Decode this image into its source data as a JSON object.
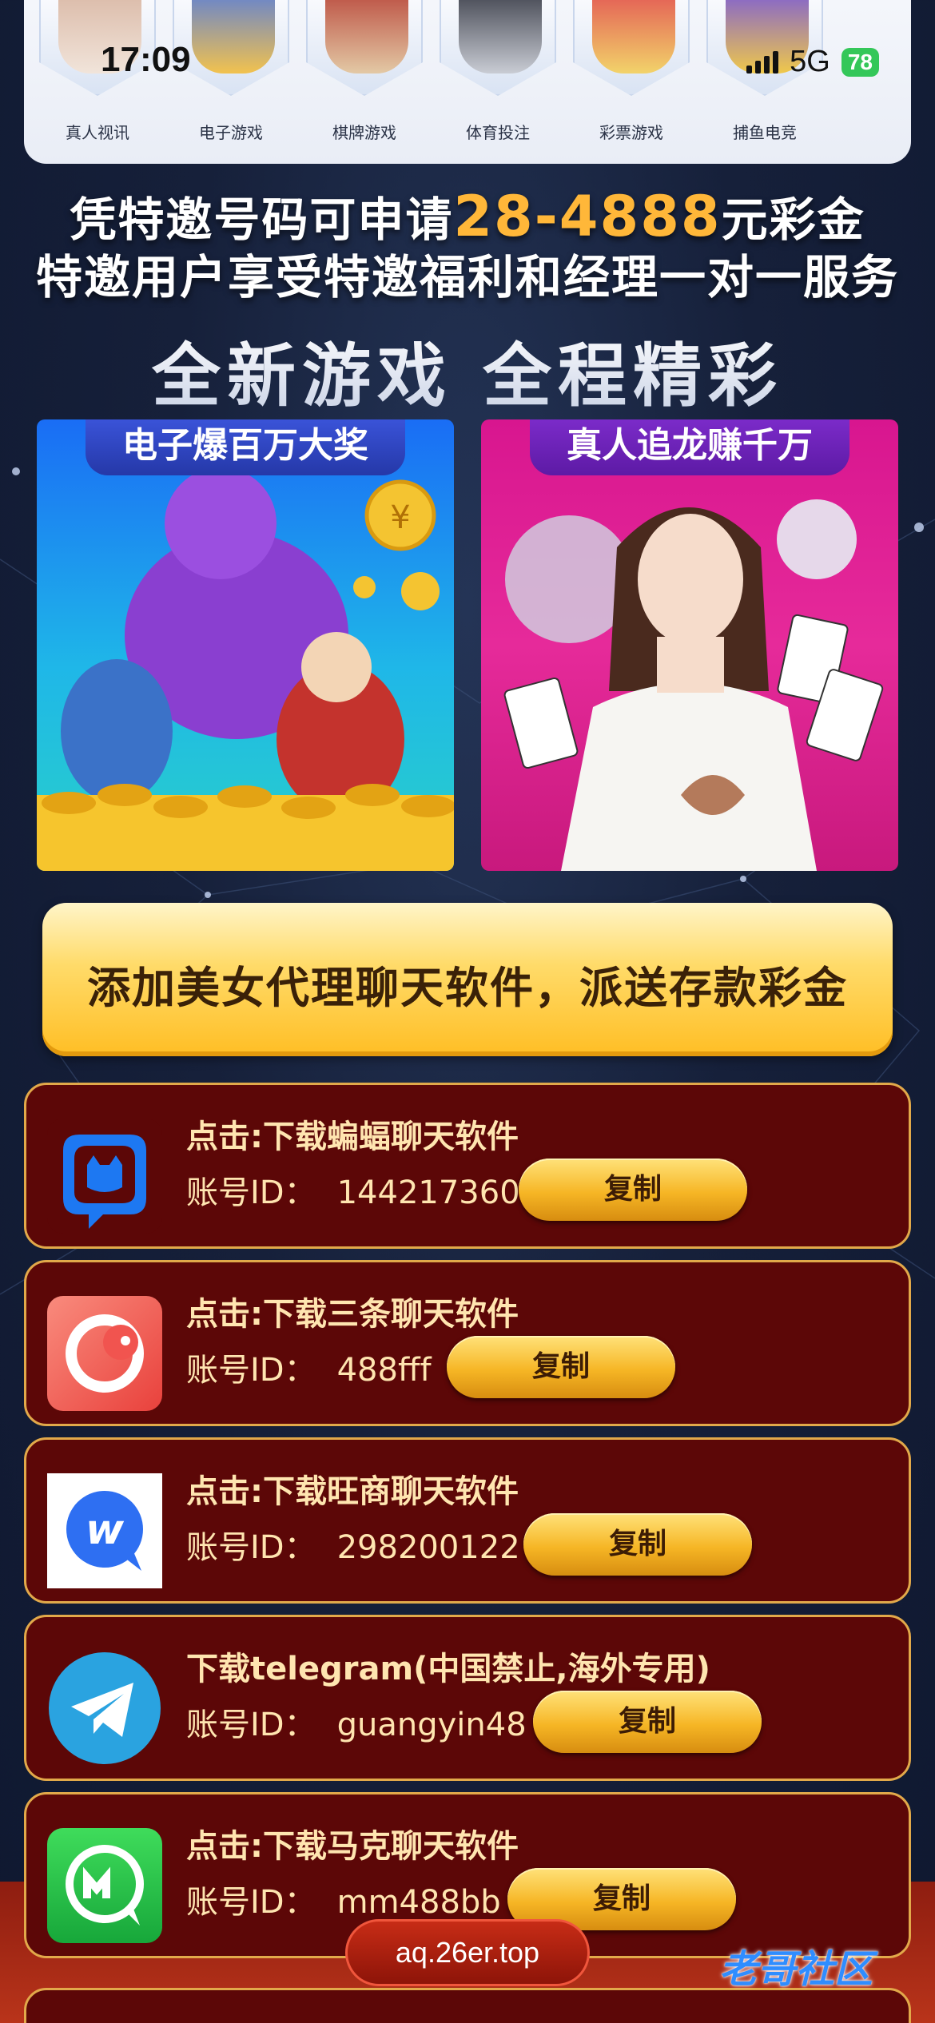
{
  "status_bar": {
    "time": "17:09",
    "network": "5G",
    "battery": "78"
  },
  "categories": [
    {
      "label": "真人视讯"
    },
    {
      "label": "电子游戏"
    },
    {
      "label": "棋牌游戏"
    },
    {
      "label": "体育投注"
    },
    {
      "label": "彩票游戏"
    },
    {
      "label": "捕鱼电竞"
    }
  ],
  "headline": {
    "line1_prefix": "凭特邀号码可申请",
    "line1_amount": "28-4888",
    "line1_suffix": "元彩金",
    "line2": "特邀用户享受特邀福利和经理一对一服务",
    "line3": "全新游戏 全程精彩"
  },
  "promos": [
    {
      "tag": "电子爆百万大奖"
    },
    {
      "tag": "真人追龙赚千万"
    }
  ],
  "cta": {
    "text": "添加美女代理聊天软件，派送存款彩金"
  },
  "download_cards": [
    {
      "title": "点击:下载蝙蝠聊天软件",
      "id_label": "账号ID：",
      "id_value": "144217360",
      "copy_label": "复制",
      "icon": "bat-chat-icon",
      "icon_color": "#1d78f2"
    },
    {
      "title": "点击:下载三条聊天软件",
      "id_label": "账号ID：",
      "id_value": "488fff",
      "copy_label": "复制",
      "icon": "santiao-icon",
      "icon_color": "#f1544f"
    },
    {
      "title": "点击:下载旺商聊天软件",
      "id_label": "账号ID：",
      "id_value": "298200122",
      "copy_label": "复制",
      "icon": "wangshang-icon",
      "icon_color": "#2e6ff2"
    },
    {
      "title": "下载telegram(中国禁止,海外专用)",
      "id_label": "账号ID：",
      "id_value": "guangyin48",
      "copy_label": "复制",
      "icon": "telegram-icon",
      "icon_color": "#2aa3e0"
    },
    {
      "title": "点击:下载马克聊天软件",
      "id_label": "账号ID：",
      "id_value": "mm488bb",
      "copy_label": "复制",
      "icon": "mark-chat-icon",
      "icon_color": "#22c04a"
    }
  ],
  "footer": {
    "url": "aq.26er.top",
    "watermark": "老哥社区"
  },
  "colors": {
    "accent_gold": "#ffb739",
    "card_bg": "#5c0707",
    "card_border": "#e2a94a"
  }
}
